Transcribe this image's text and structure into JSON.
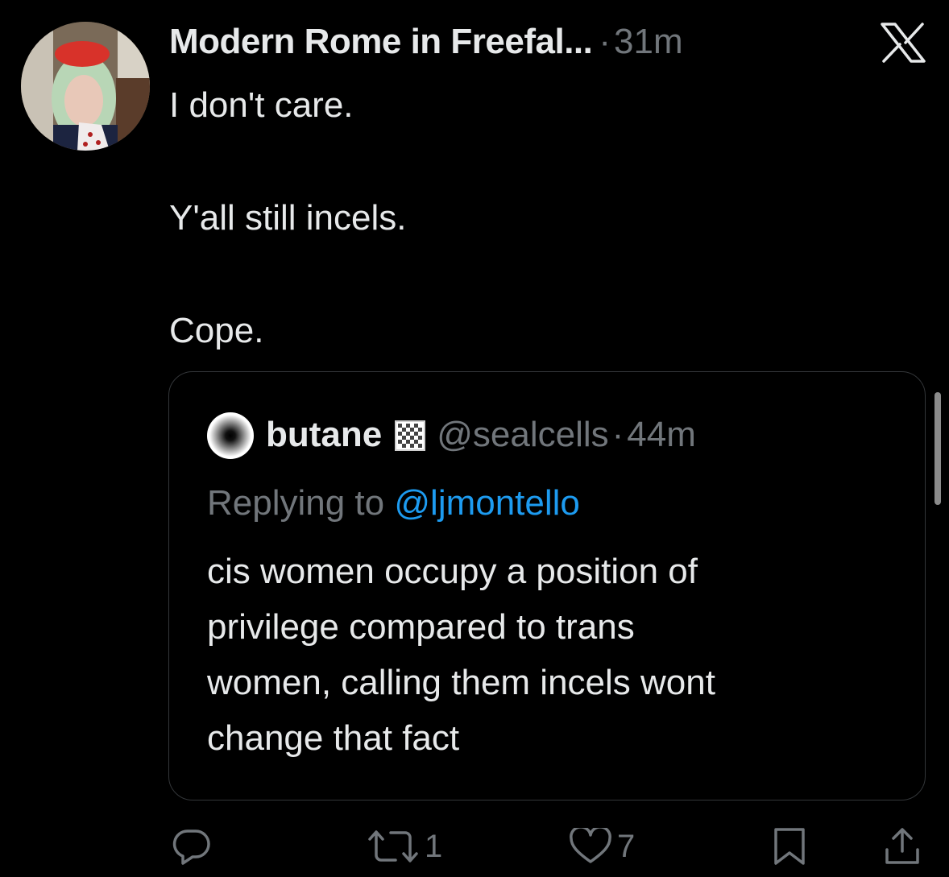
{
  "tweet": {
    "display_name": "Modern Rome in Freefal...",
    "separator": "·",
    "time": "31m",
    "text_lines": [
      "I don't care.",
      "Y'all still incels.",
      "Cope."
    ],
    "avatar_icon": "profile-photo"
  },
  "window": {
    "close_icon": "x-logo-icon"
  },
  "quote": {
    "display_name": "butane",
    "flag_icon": "checkered-flag-emoji",
    "handle": "@sealcells",
    "separator": "·",
    "time": "44m",
    "replying_prefix": "Replying to",
    "replying_to": "@ljmontello",
    "text_lines": [
      "cis women occupy a position of",
      "privilege compared to trans",
      "women, calling them incels wont",
      "change that fact"
    ]
  },
  "actions": {
    "reply_icon": "reply-icon",
    "retweet_icon": "retweet-icon",
    "retweet_count": "1",
    "like_icon": "heart-icon",
    "like_count": "7",
    "bookmark_icon": "bookmark-icon",
    "share_icon": "share-icon"
  },
  "colors": {
    "background": "#000000",
    "text_primary": "#e7e9ea",
    "text_secondary": "#71767b",
    "link": "#1d9bf0",
    "border": "#333639"
  }
}
